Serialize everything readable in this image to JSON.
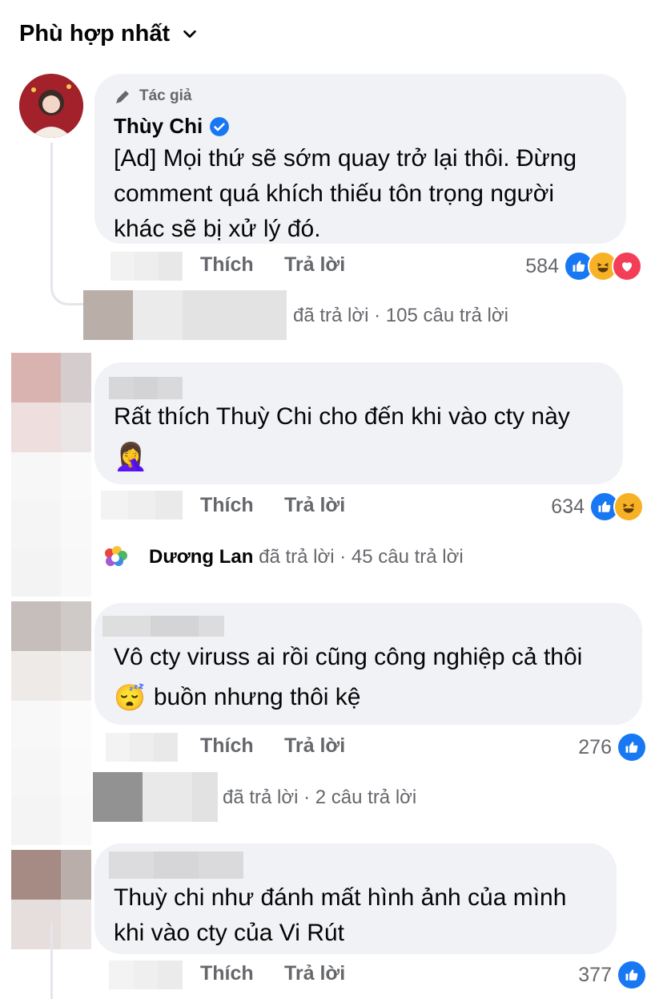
{
  "sort_label": "Phù hợp nhất",
  "colors": {
    "bubble": "#f0f2f5",
    "like": "#1877f2",
    "verified": "#1877f2",
    "muted": "#65676b"
  },
  "comments": [
    {
      "badge": "Tác giả",
      "author": "Thùy Chi",
      "verified": true,
      "lines": [
        "[Ad] Mọi thứ sẽ sớm quay trở lại thôi. Đừng",
        "comment quá khích thiếu tôn trọng người",
        "khác sẽ bị xử lý đó."
      ],
      "like_label": "Thích",
      "reply_label": "Trả lời",
      "reactions": "584",
      "reply_summary": "đã trả lời · 105 câu trả lời"
    },
    {
      "lines": [
        "Rất thích Thuỳ Chi cho đến khi vào cty này"
      ],
      "emoji": "🤦‍♀️",
      "like_label": "Thích",
      "reply_label": "Trả lời",
      "reactions": "634",
      "reply_author": "Dương Lan",
      "reply_summary": "đã trả lời · 45 câu trả lời"
    },
    {
      "lines": [
        "Vô cty viruss ai rồi cũng công nghiệp cả thôi"
      ],
      "emoji": "😴",
      "line2": "buồn nhưng thôi kệ",
      "like_label": "Thích",
      "reply_label": "Trả lời",
      "reactions": "276",
      "reply_summary": "đã trả lời · 2 câu trả lời"
    },
    {
      "lines": [
        "Thuỳ chi như đánh mất hình ảnh của mình",
        "khi vào cty của Vi Rút"
      ],
      "like_label": "Thích",
      "reply_label": "Trả lời",
      "reactions": "377"
    }
  ]
}
